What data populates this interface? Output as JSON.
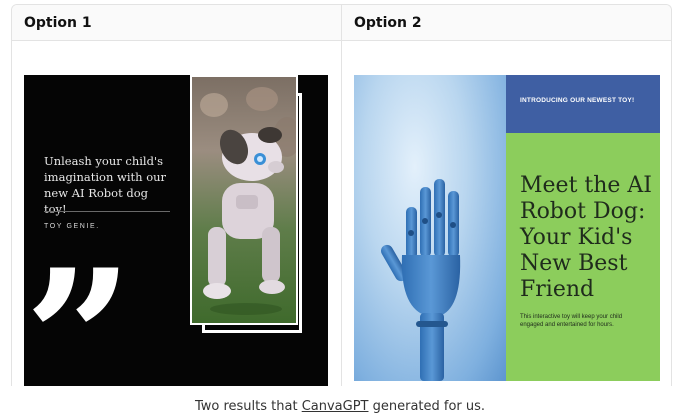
{
  "table": {
    "columns": [
      {
        "header": "Option 1"
      },
      {
        "header": "Option 2"
      }
    ]
  },
  "option1": {
    "tagline": "Unleash your child's imagination with our new AI Robot dog toy!",
    "brand": "TOY GENIE.",
    "quote_mark": "”"
  },
  "option2": {
    "banner": "INTRODUCING OUR NEWEST TOY!",
    "title": "Meet the AI Robot Dog: Your Kid's New Best Friend",
    "body": "This interactive toy will keep your child engaged and entertained for hours."
  },
  "caption": {
    "prefix": "Two results that ",
    "link": "CanvaGPT",
    "suffix": " generated for us."
  },
  "colors": {
    "poster1_bg": "#050505",
    "poster2_banner": "#3f5fa3",
    "poster2_green": "#8ccd5c"
  },
  "icons": {
    "robot_dog": "robot-dog-image",
    "wooden_hand": "wooden-hand-image"
  }
}
